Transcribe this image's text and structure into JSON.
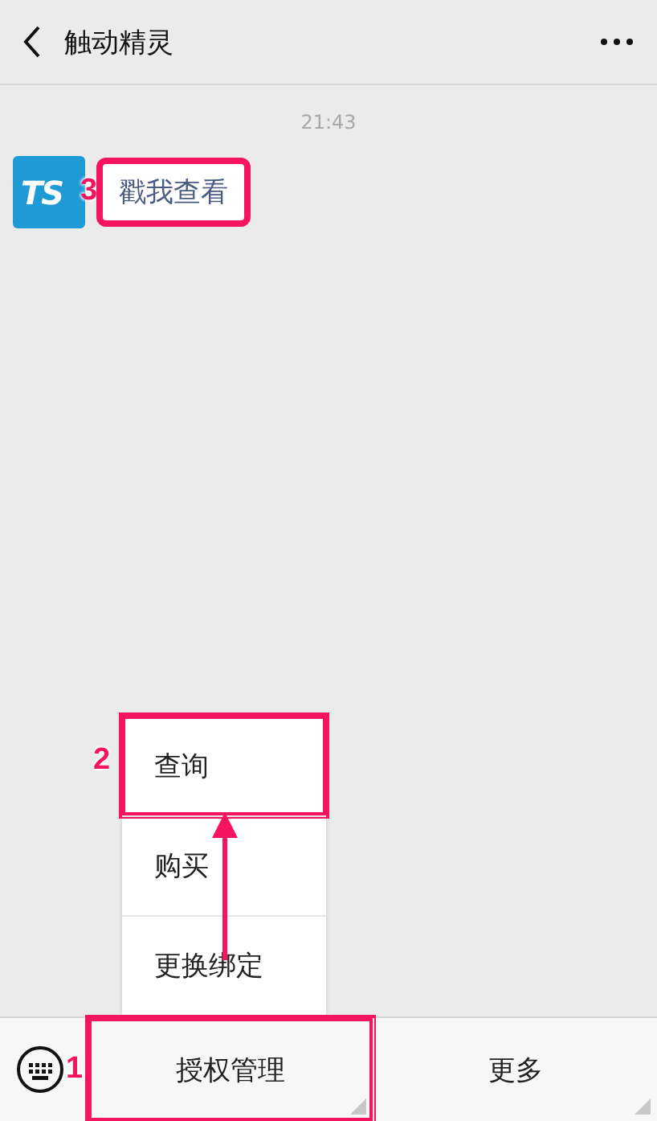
{
  "header": {
    "title": "触动精灵"
  },
  "time": "21:43",
  "messages": [
    {
      "avatar_text": "TS",
      "text": "戳我查看",
      "callout": "3"
    }
  ],
  "popup_menu": {
    "items": [
      {
        "label": "查询",
        "callout": "2"
      },
      {
        "label": "购买"
      },
      {
        "label": "更换绑定"
      }
    ]
  },
  "bottom_bar": {
    "buttons": [
      {
        "label": "授权管理",
        "callout": "1"
      },
      {
        "label": "更多"
      }
    ]
  }
}
